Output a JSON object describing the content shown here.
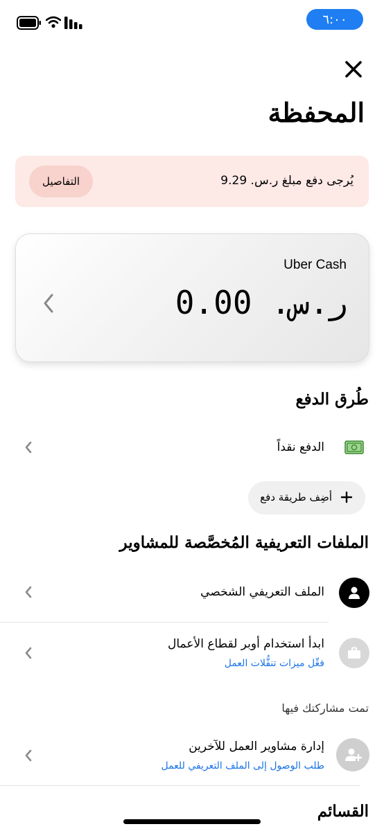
{
  "status_bar": {
    "time": "٦:٠٠",
    "accent_color": "#1e7ef2",
    "icons": [
      "battery-icon",
      "wifi-icon",
      "signal-icon"
    ]
  },
  "header": {
    "title": "المحفظة",
    "close_icon": "close-icon"
  },
  "alert": {
    "message": "يُرجى دفع مبلغ ر.س. 9.29",
    "button_label": "التفاصيل",
    "background": "#fde9e6"
  },
  "uber_cash": {
    "label": "Uber Cash",
    "amount": "ر.س. 0.00"
  },
  "payment_methods": {
    "title": "طُرق الدفع",
    "items": [
      {
        "label": "الدفع نقداً",
        "icon": "cash-icon"
      }
    ],
    "add_button_label": "أضِف طريقة دفع"
  },
  "ride_profiles": {
    "title": "الملفات التعريفية المُخصَّصة للمشاوير",
    "items": [
      {
        "label": "الملف التعريفي الشخصي",
        "icon": "person-icon"
      },
      {
        "label": "ابدأ استخدام أوبر لقطاع الأعمال",
        "sublabel": "فعِّل ميزات تنقُّلات العمل",
        "icon": "briefcase-icon"
      }
    ]
  },
  "shared": {
    "title": "تمت مشاركتك فيها",
    "items": [
      {
        "label": "إدارة مشاوير العمل للآخرين",
        "sublabel": "طلب الوصول إلى الملف التعريفي للعمل",
        "icon": "add-person-icon"
      }
    ]
  },
  "lists": {
    "title": "القسائم"
  }
}
